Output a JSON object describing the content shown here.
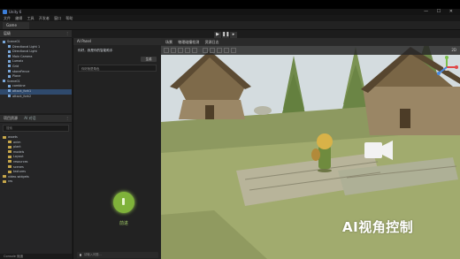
{
  "app": {
    "title": "Unity 6"
  },
  "menu": [
    "文件",
    "编辑",
    "工具",
    "开发者",
    "窗口",
    "帮助"
  ],
  "tabs": {
    "main": "Game"
  },
  "hierarchy": {
    "title": "层级",
    "items": [
      "Scene01",
      "Directional Light 1",
      "Directional Light",
      "Main Camera",
      "Lumaix",
      "Grid",
      "stoneFence",
      "Plane",
      "Scene01",
      "combine",
      "attack_fork1",
      "attack_fork2"
    ]
  },
  "project": {
    "title": "项目资源",
    "tab2": "AI 对话",
    "search_placeholder": "搜索",
    "folders": [
      "assets",
      "anim",
      "plant",
      "models",
      "Layout",
      "resources",
      "scenes",
      "textures",
      "video-widgets",
      "res"
    ]
  },
  "ai_panel": {
    "title": "AI Panel",
    "message": "你好，我是你的智能助手",
    "generate_label": "生成",
    "input_text": "你好我是角色",
    "walk_label": "前进",
    "chat_placeholder": "请输入问题..."
  },
  "viewport": {
    "tabs": [
      "场景",
      "物理碰撞检测",
      "资源日志"
    ],
    "overlay_text": "AI视角控制",
    "right_label": "2D"
  },
  "status": {
    "text": "Console 就绪"
  },
  "colors": {
    "accent": "#7fb23a",
    "highlight": "#2f4a6d",
    "panel": "#252526"
  }
}
